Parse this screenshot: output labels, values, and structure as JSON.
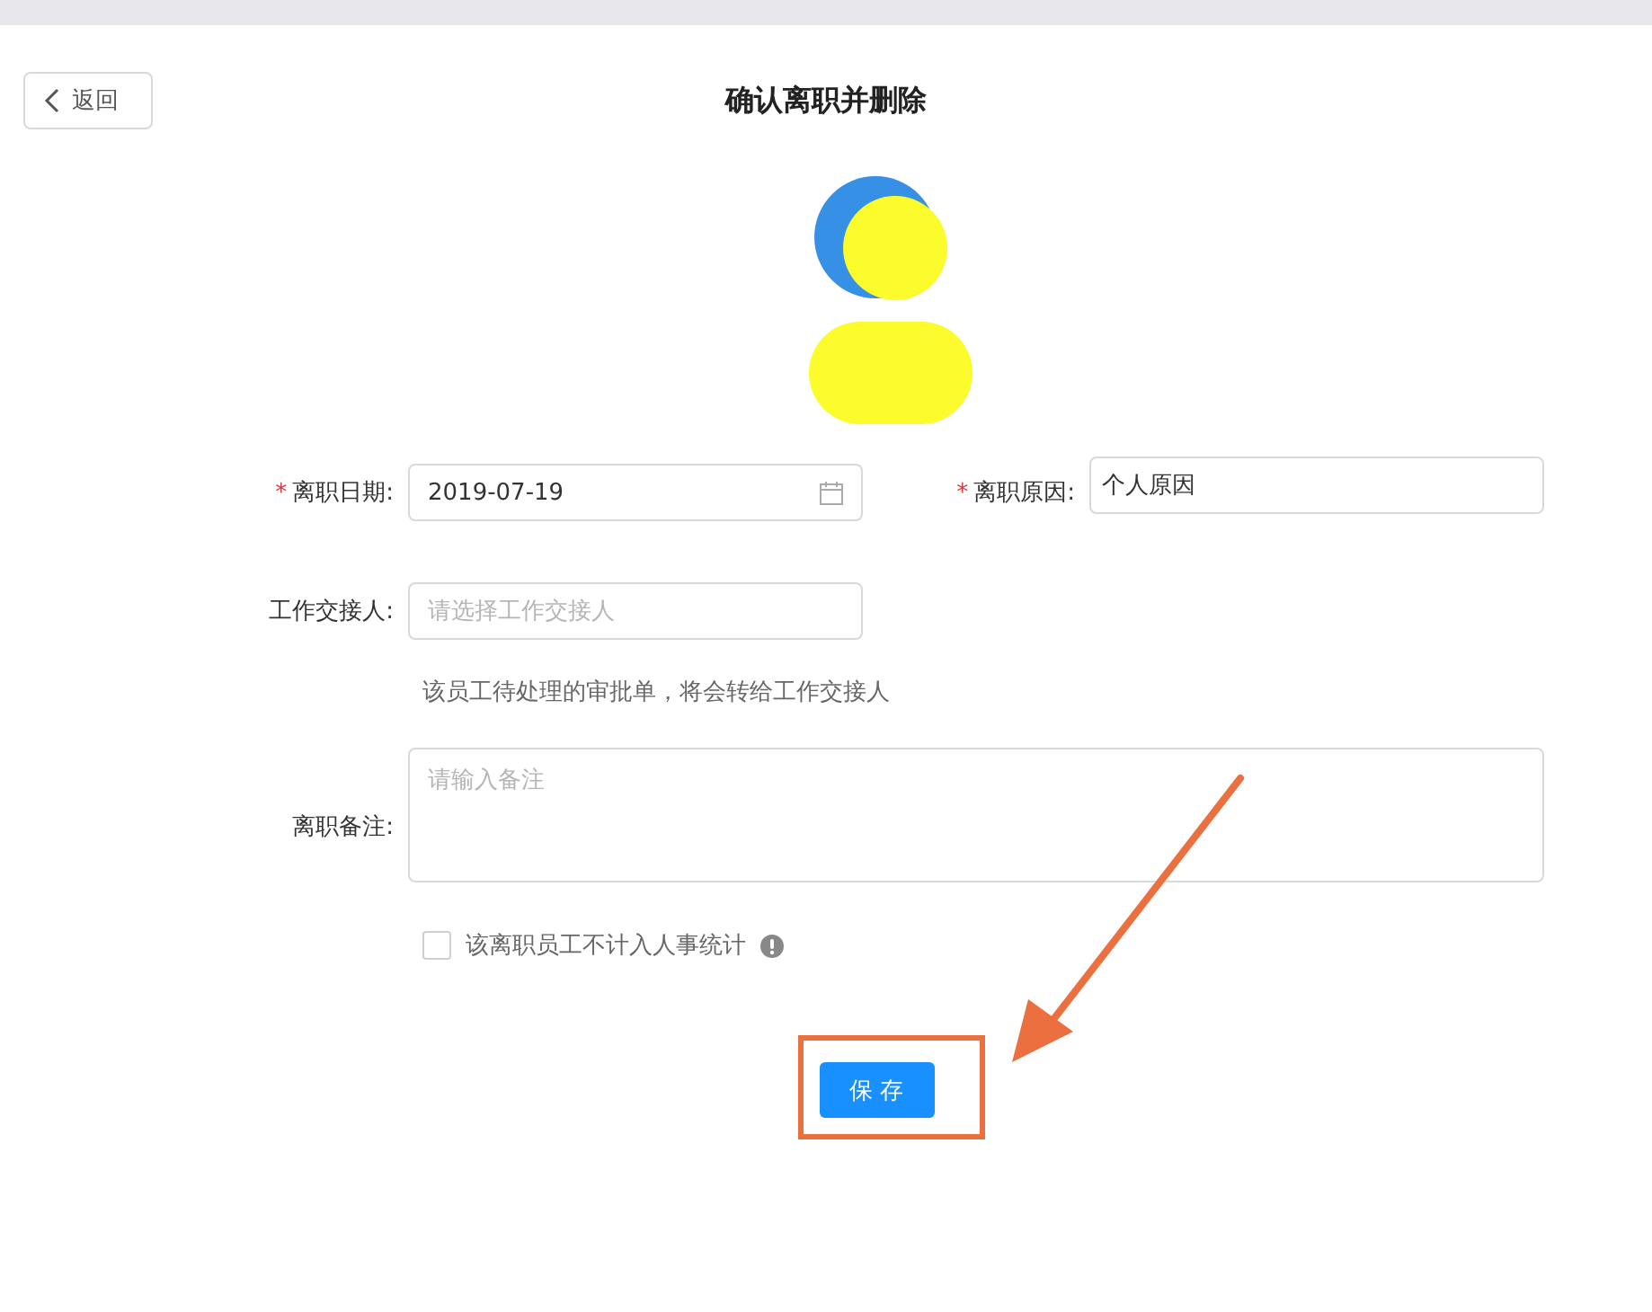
{
  "header": {
    "back_label": "返回",
    "title": "确认离职并删除"
  },
  "form": {
    "rows": [
      {
        "kind": "pair",
        "fields": [
          {
            "kind": "date",
            "required_mark": "*",
            "label": "离职日期:",
            "value": "2019-07-19"
          },
          {
            "kind": "text",
            "required_mark": "*",
            "label": "离职原因:",
            "value": "个人原因"
          }
        ]
      },
      {
        "kind": "single",
        "fields": [
          {
            "kind": "select",
            "label": "工作交接人:",
            "placeholder": "请选择工作交接人"
          }
        ],
        "hint": "该员工待处理的审批单，将会转给工作交接人"
      },
      {
        "kind": "single",
        "fields": [
          {
            "kind": "textarea",
            "label": "离职备注:",
            "placeholder": "请输入备注"
          }
        ]
      }
    ],
    "checkbox": {
      "label": "该离职员工不计入人事统计",
      "checked": false
    },
    "save_label": "保 存"
  }
}
